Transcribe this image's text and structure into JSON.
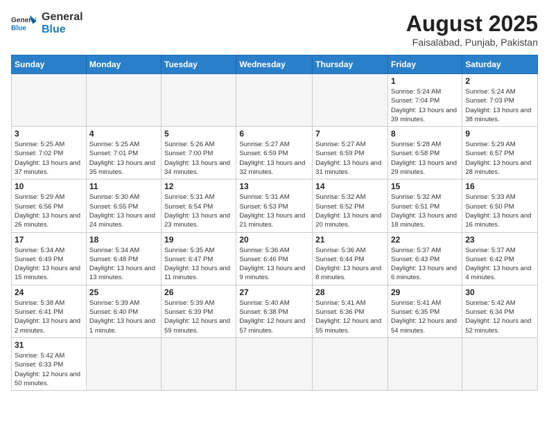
{
  "header": {
    "logo_general": "General",
    "logo_blue": "Blue",
    "month_year": "August 2025",
    "location": "Faisalabad, Punjab, Pakistan"
  },
  "days_of_week": [
    "Sunday",
    "Monday",
    "Tuesday",
    "Wednesday",
    "Thursday",
    "Friday",
    "Saturday"
  ],
  "weeks": [
    [
      {
        "day": null,
        "info": null
      },
      {
        "day": null,
        "info": null
      },
      {
        "day": null,
        "info": null
      },
      {
        "day": null,
        "info": null
      },
      {
        "day": null,
        "info": null
      },
      {
        "day": "1",
        "info": "Sunrise: 5:24 AM\nSunset: 7:04 PM\nDaylight: 13 hours and 39 minutes."
      },
      {
        "day": "2",
        "info": "Sunrise: 5:24 AM\nSunset: 7:03 PM\nDaylight: 13 hours and 38 minutes."
      }
    ],
    [
      {
        "day": "3",
        "info": "Sunrise: 5:25 AM\nSunset: 7:02 PM\nDaylight: 13 hours and 37 minutes."
      },
      {
        "day": "4",
        "info": "Sunrise: 5:25 AM\nSunset: 7:01 PM\nDaylight: 13 hours and 35 minutes."
      },
      {
        "day": "5",
        "info": "Sunrise: 5:26 AM\nSunset: 7:00 PM\nDaylight: 13 hours and 34 minutes."
      },
      {
        "day": "6",
        "info": "Sunrise: 5:27 AM\nSunset: 6:59 PM\nDaylight: 13 hours and 32 minutes."
      },
      {
        "day": "7",
        "info": "Sunrise: 5:27 AM\nSunset: 6:59 PM\nDaylight: 13 hours and 31 minutes."
      },
      {
        "day": "8",
        "info": "Sunrise: 5:28 AM\nSunset: 6:58 PM\nDaylight: 13 hours and 29 minutes."
      },
      {
        "day": "9",
        "info": "Sunrise: 5:29 AM\nSunset: 6:57 PM\nDaylight: 13 hours and 28 minutes."
      }
    ],
    [
      {
        "day": "10",
        "info": "Sunrise: 5:29 AM\nSunset: 6:56 PM\nDaylight: 13 hours and 26 minutes."
      },
      {
        "day": "11",
        "info": "Sunrise: 5:30 AM\nSunset: 6:55 PM\nDaylight: 13 hours and 24 minutes."
      },
      {
        "day": "12",
        "info": "Sunrise: 5:31 AM\nSunset: 6:54 PM\nDaylight: 13 hours and 23 minutes."
      },
      {
        "day": "13",
        "info": "Sunrise: 5:31 AM\nSunset: 6:53 PM\nDaylight: 13 hours and 21 minutes."
      },
      {
        "day": "14",
        "info": "Sunrise: 5:32 AM\nSunset: 6:52 PM\nDaylight: 13 hours and 20 minutes."
      },
      {
        "day": "15",
        "info": "Sunrise: 5:32 AM\nSunset: 6:51 PM\nDaylight: 13 hours and 18 minutes."
      },
      {
        "day": "16",
        "info": "Sunrise: 5:33 AM\nSunset: 6:50 PM\nDaylight: 13 hours and 16 minutes."
      }
    ],
    [
      {
        "day": "17",
        "info": "Sunrise: 5:34 AM\nSunset: 6:49 PM\nDaylight: 13 hours and 15 minutes."
      },
      {
        "day": "18",
        "info": "Sunrise: 5:34 AM\nSunset: 6:48 PM\nDaylight: 13 hours and 13 minutes."
      },
      {
        "day": "19",
        "info": "Sunrise: 5:35 AM\nSunset: 6:47 PM\nDaylight: 13 hours and 11 minutes."
      },
      {
        "day": "20",
        "info": "Sunrise: 5:36 AM\nSunset: 6:46 PM\nDaylight: 13 hours and 9 minutes."
      },
      {
        "day": "21",
        "info": "Sunrise: 5:36 AM\nSunset: 6:44 PM\nDaylight: 13 hours and 8 minutes."
      },
      {
        "day": "22",
        "info": "Sunrise: 5:37 AM\nSunset: 6:43 PM\nDaylight: 13 hours and 6 minutes."
      },
      {
        "day": "23",
        "info": "Sunrise: 5:37 AM\nSunset: 6:42 PM\nDaylight: 13 hours and 4 minutes."
      }
    ],
    [
      {
        "day": "24",
        "info": "Sunrise: 5:38 AM\nSunset: 6:41 PM\nDaylight: 13 hours and 2 minutes."
      },
      {
        "day": "25",
        "info": "Sunrise: 5:39 AM\nSunset: 6:40 PM\nDaylight: 13 hours and 1 minute."
      },
      {
        "day": "26",
        "info": "Sunrise: 5:39 AM\nSunset: 6:39 PM\nDaylight: 12 hours and 59 minutes."
      },
      {
        "day": "27",
        "info": "Sunrise: 5:40 AM\nSunset: 6:38 PM\nDaylight: 12 hours and 57 minutes."
      },
      {
        "day": "28",
        "info": "Sunrise: 5:41 AM\nSunset: 6:36 PM\nDaylight: 12 hours and 55 minutes."
      },
      {
        "day": "29",
        "info": "Sunrise: 5:41 AM\nSunset: 6:35 PM\nDaylight: 12 hours and 54 minutes."
      },
      {
        "day": "30",
        "info": "Sunrise: 5:42 AM\nSunset: 6:34 PM\nDaylight: 12 hours and 52 minutes."
      }
    ],
    [
      {
        "day": "31",
        "info": "Sunrise: 5:42 AM\nSunset: 6:33 PM\nDaylight: 12 hours and 50 minutes."
      },
      {
        "day": null,
        "info": null
      },
      {
        "day": null,
        "info": null
      },
      {
        "day": null,
        "info": null
      },
      {
        "day": null,
        "info": null
      },
      {
        "day": null,
        "info": null
      },
      {
        "day": null,
        "info": null
      }
    ]
  ]
}
